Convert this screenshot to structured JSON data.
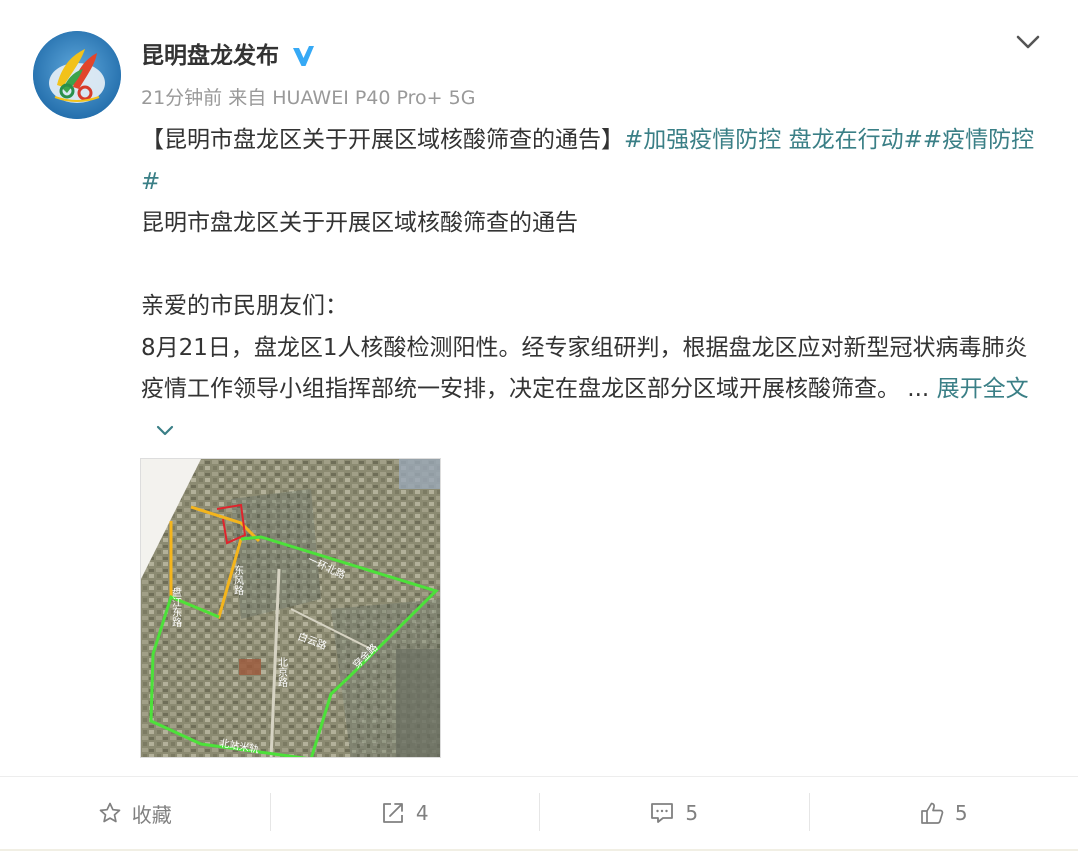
{
  "post": {
    "author": "昆明盘龙发布",
    "meta": "21分钟前 来自 HUAWEI P40 Pro+ 5G",
    "title_prefix": "【昆明市盘龙区关于开展区域核酸筛查的通告】",
    "tag1": "#加强疫情防控 盘龙在行动#",
    "tag2": "#疫情防控#",
    "line_title": "昆明市盘龙区关于开展区域核酸筛查的通告",
    "greeting": "亲爱的市民朋友们：",
    "body": "8月21日，盘龙区1人核酸检测阳性。经专家组研判，根据盘龙区应对新型冠状病毒肺炎疫情工作领导小组指挥部统一安排，决定在盘龙区部分区域开展核酸筛查。",
    "ellipsis": " ... ",
    "expand_label": "展开全文"
  },
  "map": {
    "labels": {
      "road1": "一环北路",
      "road2": "盘江东路",
      "road3": "白云路",
      "road4": "北京路",
      "road5": "北站米轨",
      "road6": "东风路",
      "road7": "穿金路"
    }
  },
  "actions": {
    "favorite_label": "收藏",
    "repost_count": "4",
    "comment_count": "5",
    "like_count": "5"
  },
  "colors": {
    "accent_link": "#3a7f86",
    "verified_blue": "#36a9f5",
    "text_main": "#333333",
    "text_meta": "#999999",
    "boundary_green": "#4ce13a",
    "boundary_orange": "#f4b51c",
    "boundary_red": "#e0242c"
  },
  "icons": {
    "verified": "verified-v-icon",
    "menu": "chevron-down-icon",
    "expand": "chevron-down-icon",
    "favorite": "star-icon",
    "repost": "share-arrow-icon",
    "comment": "comment-icon",
    "like": "thumbs-up-icon"
  }
}
